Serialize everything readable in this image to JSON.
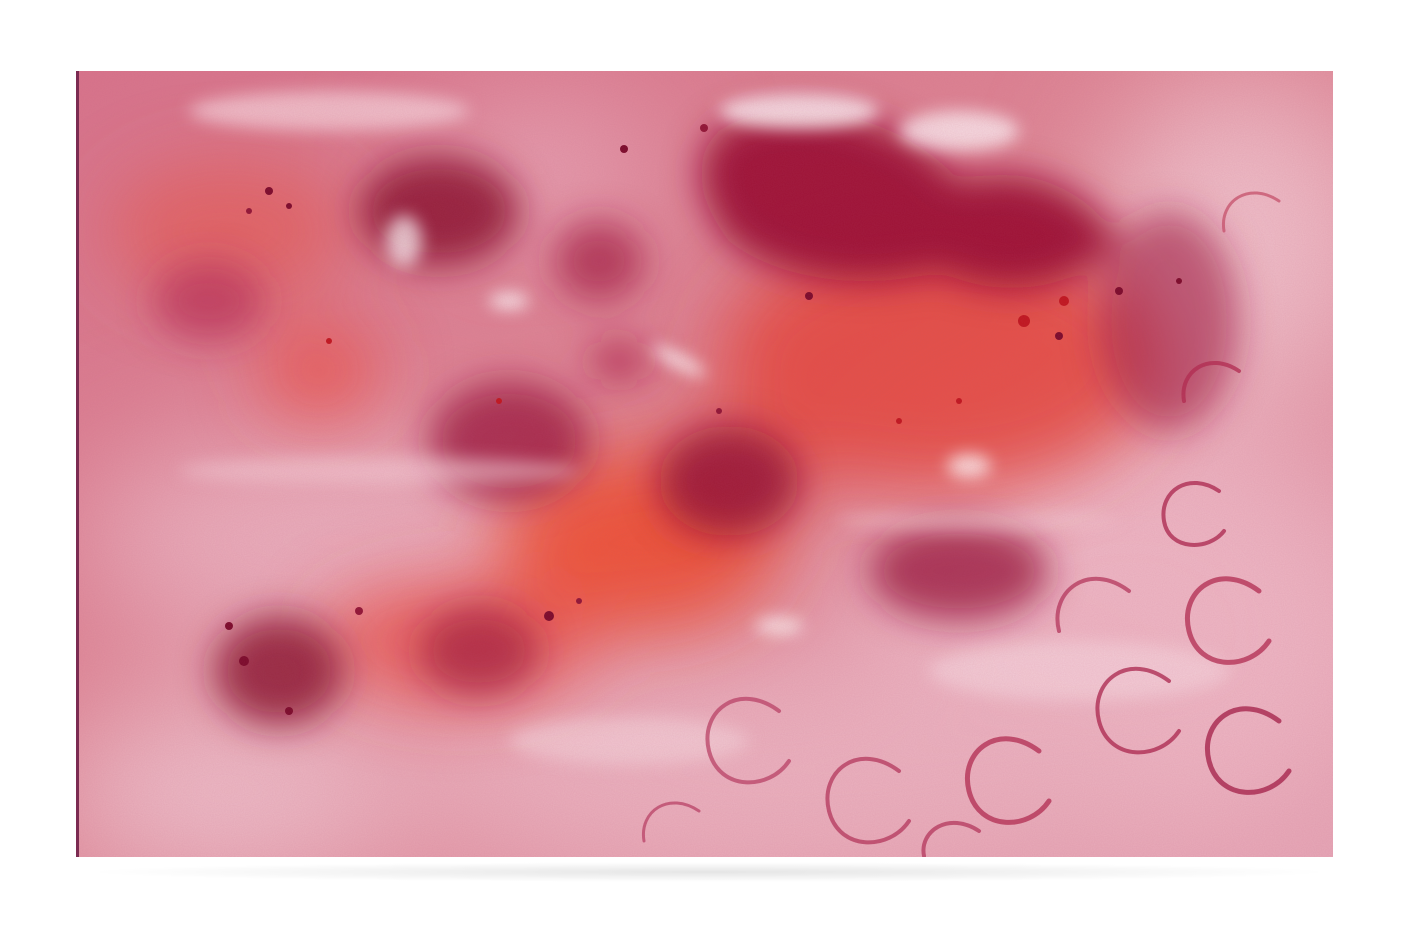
{
  "artwork": {
    "palette": {
      "base": "#d9818f",
      "crimson": "#9c1538",
      "deep_crimson": "#7a0a2a",
      "vermilion": "#e8392a",
      "pink": "#e9a3b2",
      "blush": "#f3cdd6",
      "white": "#fbeef1"
    }
  }
}
